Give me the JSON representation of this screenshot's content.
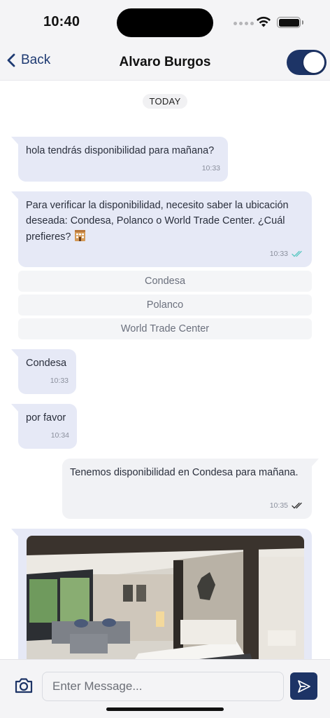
{
  "status": {
    "time": "10:40"
  },
  "nav": {
    "back_label": "Back",
    "title": "Alvaro Burgos",
    "toggle_on": true
  },
  "chat": {
    "date_label": "TODAY",
    "messages": [
      {
        "text": "hola tendrás disponibilidad para mañana?",
        "time": "10:33"
      },
      {
        "text": "Para verificar la disponibilidad, necesito saber la ubicación deseada: Condesa, Polanco o World Trade Center. ¿Cuál prefieres?",
        "time": "10:33"
      },
      {
        "text": "Condesa",
        "time": "10:33"
      },
      {
        "text": "por favor",
        "time": "10:34"
      },
      {
        "text": "Tenemos disponibilidad en Condesa para mañana.",
        "time": "10:35"
      }
    ],
    "quick_replies": [
      "Condesa",
      "Polanco",
      "World Trade Center"
    ]
  },
  "composer": {
    "placeholder": "Enter Message..."
  },
  "colors": {
    "brand": "#1d3466",
    "incoming_bubble": "#e6e9f6",
    "read_tick": "#5fc9c4"
  },
  "icons": [
    "chevron-left-icon",
    "wifi-icon",
    "battery-icon",
    "hotel-icon",
    "double-check-icon",
    "camera-icon",
    "send-icon"
  ]
}
